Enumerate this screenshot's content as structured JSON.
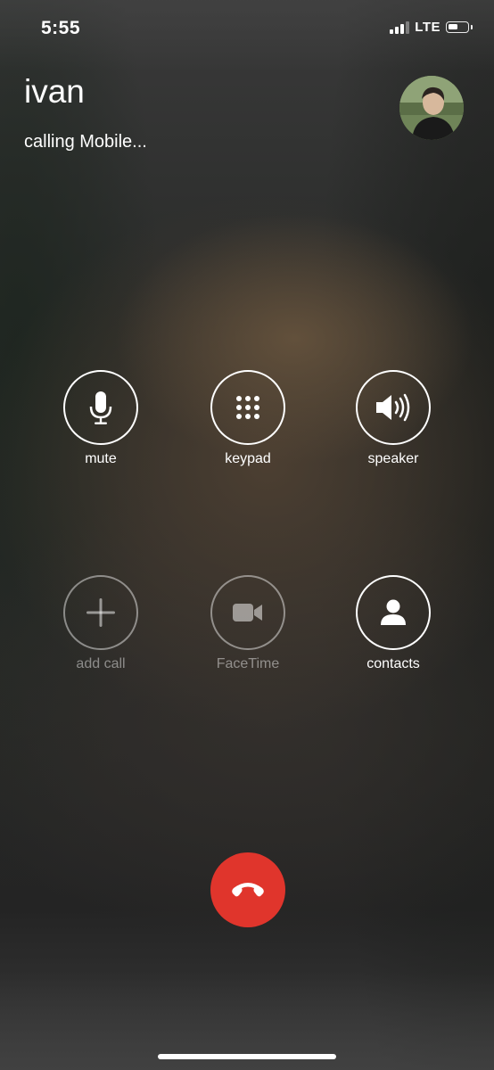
{
  "status_bar": {
    "time": "5:55",
    "network": "LTE",
    "signal_bars": 4,
    "signal_bars_filled": 3,
    "battery_level": 0.55
  },
  "caller": {
    "name": "ivan",
    "status": "calling Mobile...",
    "avatar_icon": "contact-photo"
  },
  "controls": {
    "mute": {
      "label": "mute",
      "icon": "microphone-icon",
      "enabled": true
    },
    "keypad": {
      "label": "keypad",
      "icon": "keypad-icon",
      "enabled": true
    },
    "speaker": {
      "label": "speaker",
      "icon": "speaker-icon",
      "enabled": true
    },
    "add_call": {
      "label": "add call",
      "icon": "plus-icon",
      "enabled": false
    },
    "facetime": {
      "label": "FaceTime",
      "icon": "video-camera-icon",
      "enabled": false
    },
    "contacts": {
      "label": "contacts",
      "icon": "person-icon",
      "enabled": true
    }
  },
  "end_call": {
    "icon": "hang-up-icon",
    "color": "#e0352c"
  }
}
